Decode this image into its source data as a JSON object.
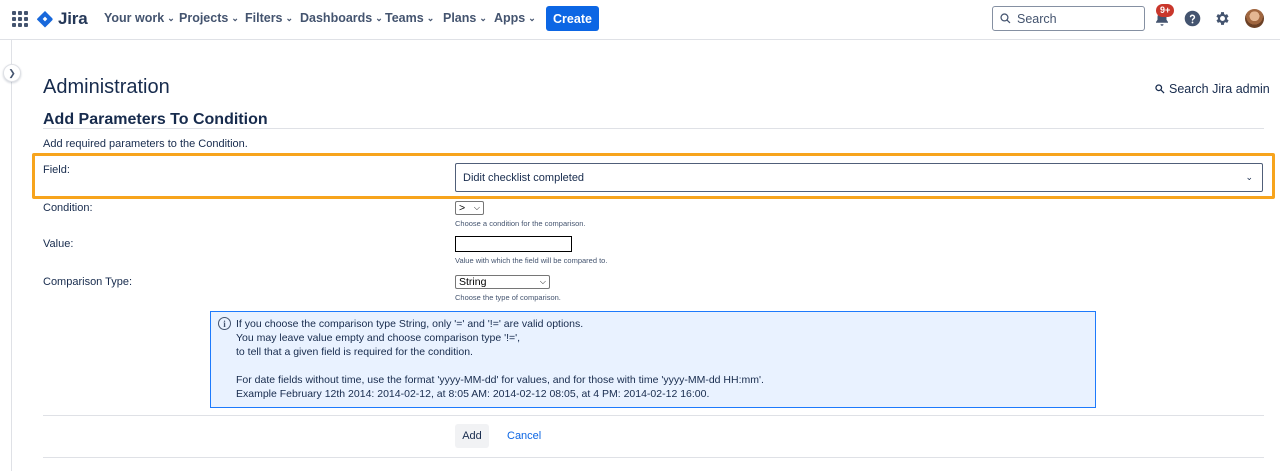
{
  "nav": {
    "logo_text": "Jira",
    "items": [
      {
        "label": "Your work"
      },
      {
        "label": "Projects"
      },
      {
        "label": "Filters"
      },
      {
        "label": "Dashboards"
      },
      {
        "label": "Teams"
      },
      {
        "label": "Plans"
      },
      {
        "label": "Apps"
      }
    ],
    "create_label": "Create",
    "search_placeholder": "Search",
    "notification_badge": "9+"
  },
  "page": {
    "title": "Administration",
    "admin_search_label": "Search Jira admin",
    "section_title": "Add Parameters To Condition",
    "description": "Add required parameters to the Condition."
  },
  "form": {
    "field_label": "Field:",
    "field_value": "Didit checklist completed",
    "condition_label": "Condition:",
    "condition_value": ">",
    "condition_hint": "Choose a condition for the comparison.",
    "value_label": "Value:",
    "value_value": "",
    "value_hint": "Value with which the field will be compared to.",
    "comparison_label": "Comparison Type:",
    "comparison_value": "String",
    "comparison_hint": "Choose the type of comparison."
  },
  "info": {
    "lines": [
      "If you choose the comparison type String, only '=' and '!=' are valid options.",
      "You may leave value empty and choose comparison type '!=',",
      "to tell that a given field is required for the condition.",
      "For date fields without time, use the format 'yyyy-MM-dd' for values, and for those with time 'yyyy-MM-dd HH:mm'.",
      "Example February 12th 2014: 2014-02-12, at 8:05 AM: 2014-02-12 08:05, at 4 PM: 2014-02-12 16:00."
    ]
  },
  "actions": {
    "add_label": "Add",
    "cancel_label": "Cancel"
  },
  "colors": {
    "accent": "#0c66e4",
    "highlight": "#f7a41d",
    "info_bg": "#e9f2ff",
    "info_border": "#1d7afc"
  },
  "icons": [
    "apps-grid-icon",
    "jira-logo-icon",
    "chevron-down-icon",
    "search-icon",
    "bell-icon",
    "help-icon",
    "gear-icon",
    "avatar",
    "chevron-right-icon",
    "info-icon"
  ]
}
